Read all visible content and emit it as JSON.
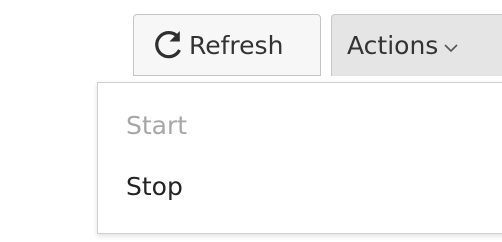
{
  "toolbar": {
    "refresh_label": "Refresh",
    "actions_label": "Actions"
  },
  "actions_menu": {
    "items": [
      {
        "label": "Start",
        "state": "disabled"
      },
      {
        "label": "Stop",
        "state": "enabled"
      }
    ]
  },
  "icons": {
    "refresh": "refresh-icon",
    "caret": "chevron-down-icon"
  },
  "colors": {
    "text": "#333333",
    "disabled_text": "#a6a6a6",
    "active_button_bg": "#e5e5e5",
    "border": "#c4c4c4"
  }
}
